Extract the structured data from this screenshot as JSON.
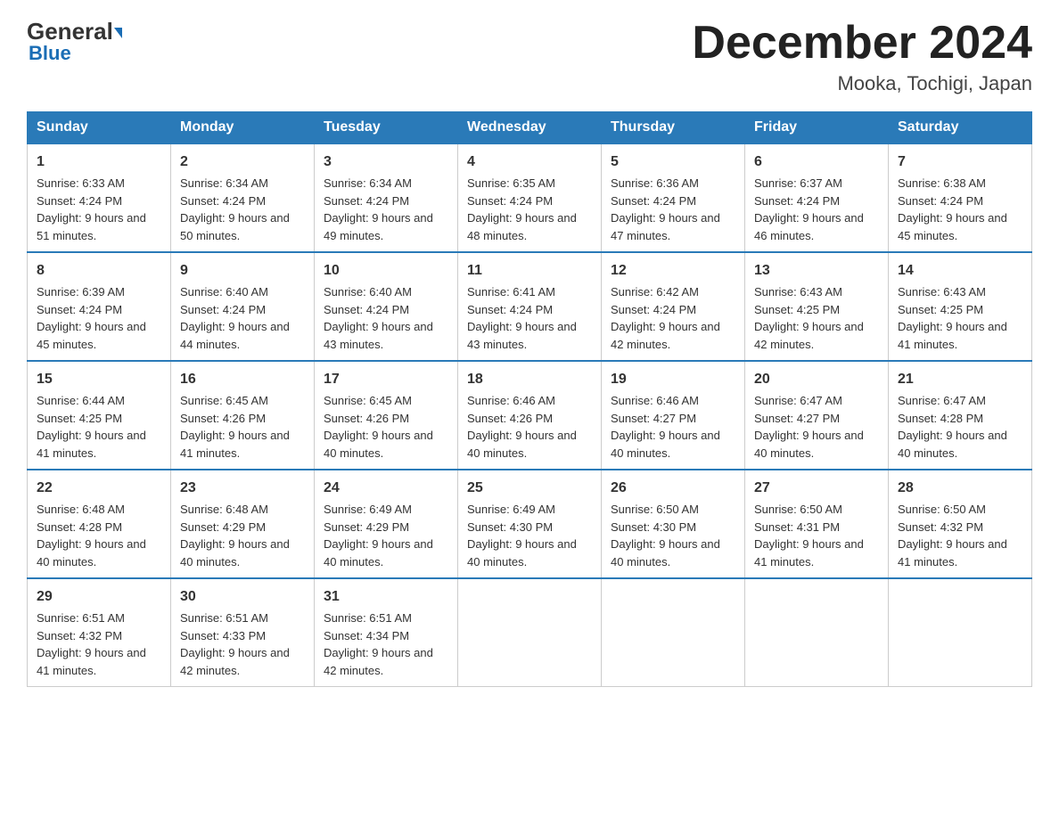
{
  "header": {
    "logo_text": "General",
    "logo_blue": "Blue",
    "month_title": "December 2024",
    "location": "Mooka, Tochigi, Japan"
  },
  "days_of_week": [
    "Sunday",
    "Monday",
    "Tuesday",
    "Wednesday",
    "Thursday",
    "Friday",
    "Saturday"
  ],
  "weeks": [
    [
      {
        "day": "1",
        "sunrise": "6:33 AM",
        "sunset": "4:24 PM",
        "daylight": "9 hours and 51 minutes."
      },
      {
        "day": "2",
        "sunrise": "6:34 AM",
        "sunset": "4:24 PM",
        "daylight": "9 hours and 50 minutes."
      },
      {
        "day": "3",
        "sunrise": "6:34 AM",
        "sunset": "4:24 PM",
        "daylight": "9 hours and 49 minutes."
      },
      {
        "day": "4",
        "sunrise": "6:35 AM",
        "sunset": "4:24 PM",
        "daylight": "9 hours and 48 minutes."
      },
      {
        "day": "5",
        "sunrise": "6:36 AM",
        "sunset": "4:24 PM",
        "daylight": "9 hours and 47 minutes."
      },
      {
        "day": "6",
        "sunrise": "6:37 AM",
        "sunset": "4:24 PM",
        "daylight": "9 hours and 46 minutes."
      },
      {
        "day": "7",
        "sunrise": "6:38 AM",
        "sunset": "4:24 PM",
        "daylight": "9 hours and 45 minutes."
      }
    ],
    [
      {
        "day": "8",
        "sunrise": "6:39 AM",
        "sunset": "4:24 PM",
        "daylight": "9 hours and 45 minutes."
      },
      {
        "day": "9",
        "sunrise": "6:40 AM",
        "sunset": "4:24 PM",
        "daylight": "9 hours and 44 minutes."
      },
      {
        "day": "10",
        "sunrise": "6:40 AM",
        "sunset": "4:24 PM",
        "daylight": "9 hours and 43 minutes."
      },
      {
        "day": "11",
        "sunrise": "6:41 AM",
        "sunset": "4:24 PM",
        "daylight": "9 hours and 43 minutes."
      },
      {
        "day": "12",
        "sunrise": "6:42 AM",
        "sunset": "4:24 PM",
        "daylight": "9 hours and 42 minutes."
      },
      {
        "day": "13",
        "sunrise": "6:43 AM",
        "sunset": "4:25 PM",
        "daylight": "9 hours and 42 minutes."
      },
      {
        "day": "14",
        "sunrise": "6:43 AM",
        "sunset": "4:25 PM",
        "daylight": "9 hours and 41 minutes."
      }
    ],
    [
      {
        "day": "15",
        "sunrise": "6:44 AM",
        "sunset": "4:25 PM",
        "daylight": "9 hours and 41 minutes."
      },
      {
        "day": "16",
        "sunrise": "6:45 AM",
        "sunset": "4:26 PM",
        "daylight": "9 hours and 41 minutes."
      },
      {
        "day": "17",
        "sunrise": "6:45 AM",
        "sunset": "4:26 PM",
        "daylight": "9 hours and 40 minutes."
      },
      {
        "day": "18",
        "sunrise": "6:46 AM",
        "sunset": "4:26 PM",
        "daylight": "9 hours and 40 minutes."
      },
      {
        "day": "19",
        "sunrise": "6:46 AM",
        "sunset": "4:27 PM",
        "daylight": "9 hours and 40 minutes."
      },
      {
        "day": "20",
        "sunrise": "6:47 AM",
        "sunset": "4:27 PM",
        "daylight": "9 hours and 40 minutes."
      },
      {
        "day": "21",
        "sunrise": "6:47 AM",
        "sunset": "4:28 PM",
        "daylight": "9 hours and 40 minutes."
      }
    ],
    [
      {
        "day": "22",
        "sunrise": "6:48 AM",
        "sunset": "4:28 PM",
        "daylight": "9 hours and 40 minutes."
      },
      {
        "day": "23",
        "sunrise": "6:48 AM",
        "sunset": "4:29 PM",
        "daylight": "9 hours and 40 minutes."
      },
      {
        "day": "24",
        "sunrise": "6:49 AM",
        "sunset": "4:29 PM",
        "daylight": "9 hours and 40 minutes."
      },
      {
        "day": "25",
        "sunrise": "6:49 AM",
        "sunset": "4:30 PM",
        "daylight": "9 hours and 40 minutes."
      },
      {
        "day": "26",
        "sunrise": "6:50 AM",
        "sunset": "4:30 PM",
        "daylight": "9 hours and 40 minutes."
      },
      {
        "day": "27",
        "sunrise": "6:50 AM",
        "sunset": "4:31 PM",
        "daylight": "9 hours and 41 minutes."
      },
      {
        "day": "28",
        "sunrise": "6:50 AM",
        "sunset": "4:32 PM",
        "daylight": "9 hours and 41 minutes."
      }
    ],
    [
      {
        "day": "29",
        "sunrise": "6:51 AM",
        "sunset": "4:32 PM",
        "daylight": "9 hours and 41 minutes."
      },
      {
        "day": "30",
        "sunrise": "6:51 AM",
        "sunset": "4:33 PM",
        "daylight": "9 hours and 42 minutes."
      },
      {
        "day": "31",
        "sunrise": "6:51 AM",
        "sunset": "4:34 PM",
        "daylight": "9 hours and 42 minutes."
      },
      null,
      null,
      null,
      null
    ]
  ]
}
